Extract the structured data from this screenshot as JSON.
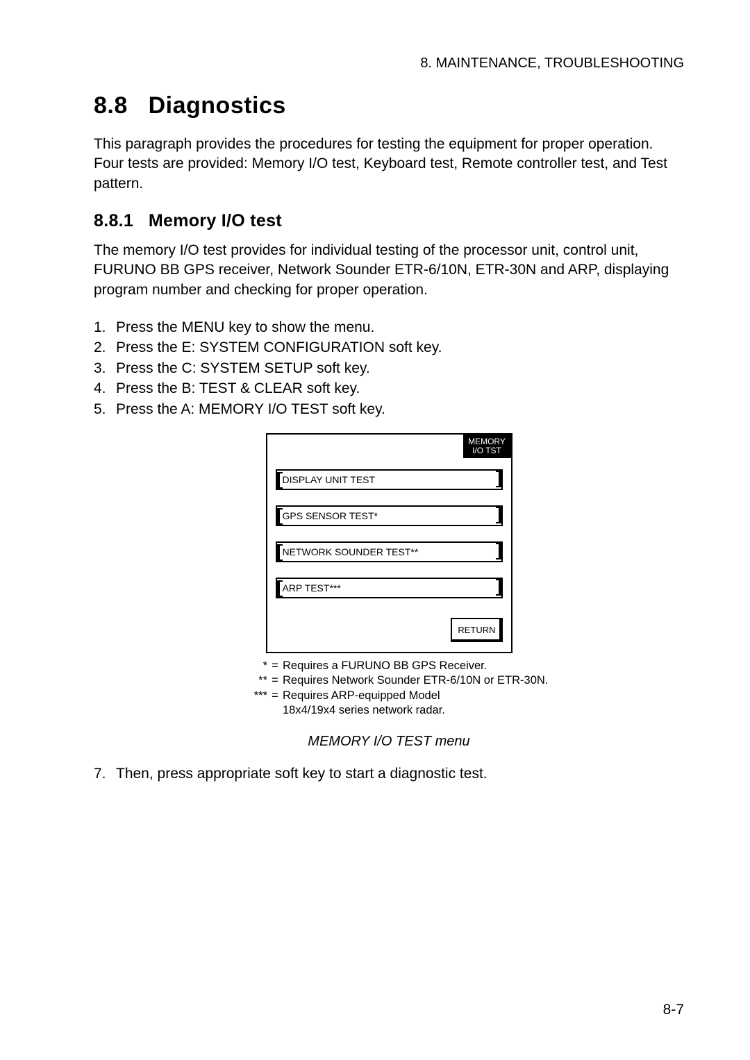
{
  "header": "8.  MAINTENANCE, TROUBLESHOOTING",
  "section": {
    "number": "8.8",
    "title": "Diagnostics"
  },
  "intro": "This paragraph provides the procedures for testing the equipment for proper operation. Four tests are provided: Memory I/O test, Keyboard test, Remote controller test, and Test pattern.",
  "subsection": {
    "number": "8.8.1",
    "title": "Memory I/O test"
  },
  "sub_intro": "The memory I/O test provides for individual testing of the processor unit, control unit, FURUNO BB GPS receiver, Network Sounder ETR-6/10N, ETR-30N and ARP, displaying program number and checking for proper operation.",
  "steps": [
    {
      "n": "1.",
      "text": "Press the MENU key to show the menu."
    },
    {
      "n": "2.",
      "text": "Press the E: SYSTEM CONFIGURATION soft key."
    },
    {
      "n": "3.",
      "text": "Press the C: SYSTEM SETUP soft key."
    },
    {
      "n": "4.",
      "text": "Press the B: TEST & CLEAR soft key."
    },
    {
      "n": "5.",
      "text": "Press the A: MEMORY I/O TEST soft key."
    }
  ],
  "menu": {
    "header_line1": "MEMORY",
    "header_line2": "I/O TST",
    "items": [
      "DISPLAY UNIT TEST",
      "GPS SENSOR TEST*",
      "NETWORK SOUNDER TEST**",
      "ARP TEST***"
    ],
    "return": "RETURN"
  },
  "notes": [
    {
      "mark": "*",
      "eq": "=",
      "text": "Requires a FURUNO BB GPS Receiver."
    },
    {
      "mark": "**",
      "eq": "=",
      "text": "Requires Network Sounder ETR-6/10N or ETR-30N."
    },
    {
      "mark": "***",
      "eq": "=",
      "text": "Requires ARP-equipped Model"
    },
    {
      "mark": "",
      "eq": "",
      "text": "18x4/19x4 series network radar."
    }
  ],
  "caption": "MEMORY I/O TEST menu",
  "step7": {
    "n": "7.",
    "text": "Then, press appropriate soft key to start a diagnostic test."
  },
  "page_number": "8-7"
}
